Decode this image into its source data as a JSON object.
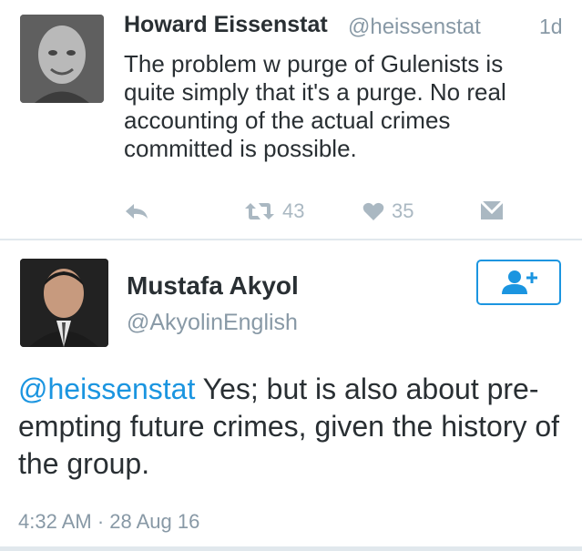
{
  "tweet1": {
    "name": "Howard Eissenstat",
    "handle": "@heissenstat",
    "time": "1d",
    "text": "The problem w purge of Gulenists is quite simply that it's a purge.  No real accounting of the actual crimes committed is possible.",
    "retweets": "43",
    "likes": "35",
    "icons": {
      "reply": "reply-icon",
      "retweet": "retweet-icon",
      "like": "heart-icon",
      "dm": "direct-message-icon"
    }
  },
  "tweet2": {
    "name": "Mustafa Akyol",
    "handle": "@AkyolinEnglish",
    "mention": "@heissenstat",
    "text_rest": " Yes; but is also about pre-empting future crimes, given the history of the group.",
    "timestamp": "4:32 AM · 28 Aug 16",
    "follow_icon": "add-user-icon"
  },
  "colors": {
    "accent": "#1b95e0",
    "secondary_text": "#8899a6",
    "action_icon": "#aab8c2",
    "primary_text": "#292f33"
  }
}
